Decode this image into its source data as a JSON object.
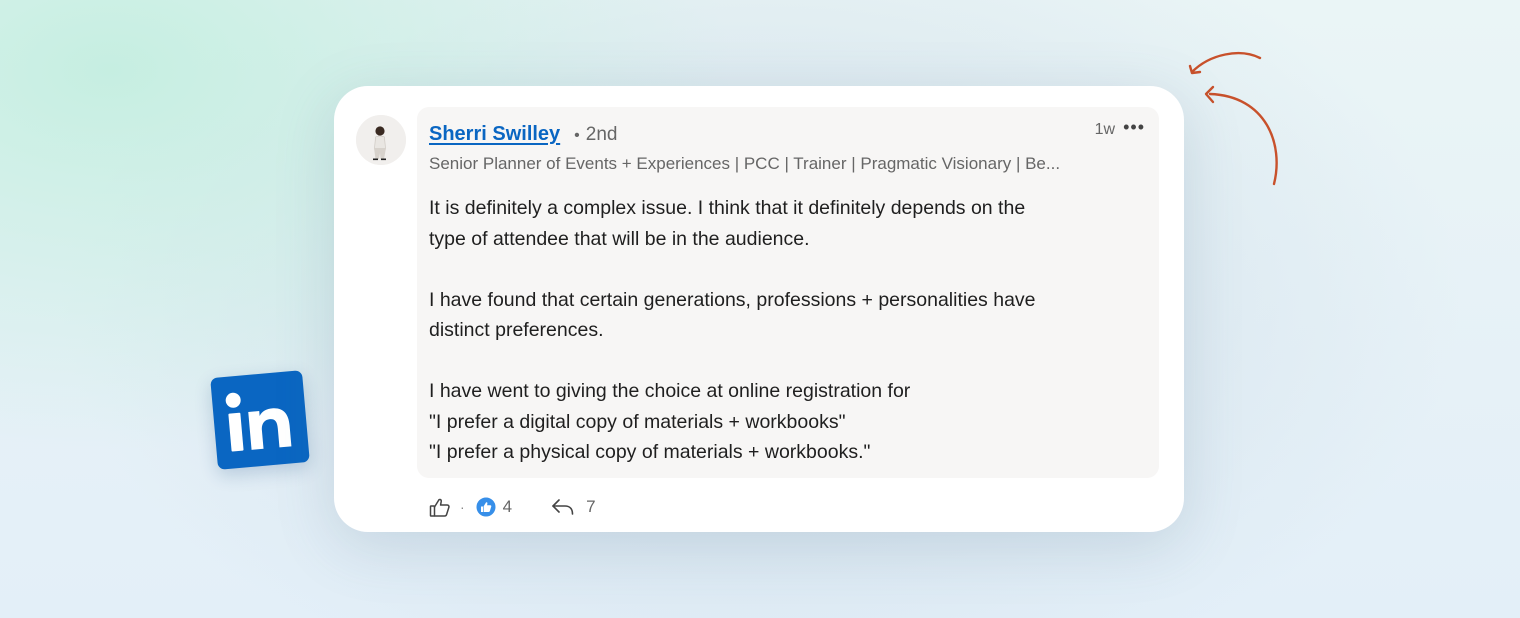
{
  "comment": {
    "author_name": "Sherri Swilley",
    "connection_degree": "2nd",
    "timestamp": "1w",
    "more_icon": "more-horizontal-icon",
    "headline": "Senior Planner of Events + Experiences | PCC | Trainer | Pragmatic Visionary | Be...",
    "paragraphs": [
      {
        "lines": [
          "It is definitely a complex issue. I think that it definitely depends on the",
          "type of attendee that will be in the audience."
        ]
      },
      {
        "lines": [
          "I have found that certain generations, professions + personalities have",
          "distinct preferences."
        ]
      },
      {
        "lines": [
          "I have went to giving the choice at online registration for",
          "\"I prefer a digital copy of materials + workbooks\"",
          "\"I prefer a physical copy of materials + workbooks.\""
        ]
      }
    ]
  },
  "actions": {
    "like_icon": "thumbs-up-outline-icon",
    "separator": "·",
    "reaction_icon": "like-reaction-icon",
    "reaction_count": "4",
    "reply_icon": "reply-arrow-icon",
    "reply_count": "7"
  },
  "decorations": {
    "logo_icon": "linkedin-logo-icon",
    "arrow_icon": "curved-arrow-icon",
    "accent_color": "#c8512b",
    "brand_color": "#0a66c2"
  }
}
